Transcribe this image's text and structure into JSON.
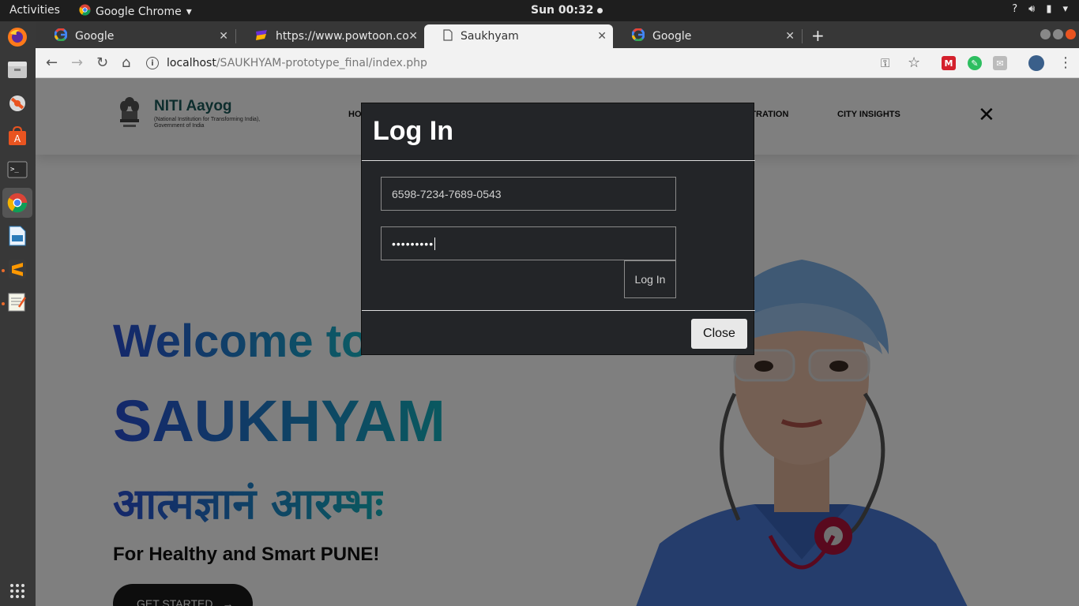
{
  "system": {
    "activities": "Activities",
    "app_name": "Google Chrome",
    "clock": "Sun 00:32",
    "tray": [
      "?",
      "volume",
      "battery",
      "power"
    ]
  },
  "dock": {
    "items": [
      "firefox-icon",
      "files-icon",
      "settings-icon",
      "software-center-icon",
      "terminal-icon",
      "chrome-icon",
      "writer-icon",
      "sublime-icon",
      "text-editor-icon"
    ],
    "apps_grid": "show-applications-icon"
  },
  "browser": {
    "tabs": [
      {
        "title": "Google",
        "icon": "google-icon"
      },
      {
        "title": "https://www.powtoon.co",
        "icon": "powtoon-icon"
      },
      {
        "title": "Saukhyam",
        "icon": "page-icon"
      },
      {
        "title": "Google",
        "icon": "google-icon"
      }
    ],
    "new_tab": "+",
    "url_host": "localhost",
    "url_path": "/SAUKHYAM-prototype_final/index.php"
  },
  "site": {
    "brand_name": "NITI Aayog",
    "brand_sub": "(National Institution for Transforming India),",
    "brand_sub2": "Government of India",
    "nav": [
      "HO",
      "STRATION",
      "CITY INSIGHTS"
    ],
    "hero_welcome": "Welcome to",
    "hero_title": "SAUKHYAM",
    "hero_hindi": "आत्मज्ञानं आरम्भः",
    "hero_tag": "For Healthy and Smart PUNE!",
    "cta": "GET STARTED",
    "colors": {
      "gradient_start": "#2a4fd6",
      "gradient_end": "#18b9c9"
    }
  },
  "modal": {
    "title": "Log In",
    "username_value": "6598-7234-7689-0543",
    "password_value": "•••••••••",
    "login_label": "Log In",
    "close_label": "Close"
  }
}
